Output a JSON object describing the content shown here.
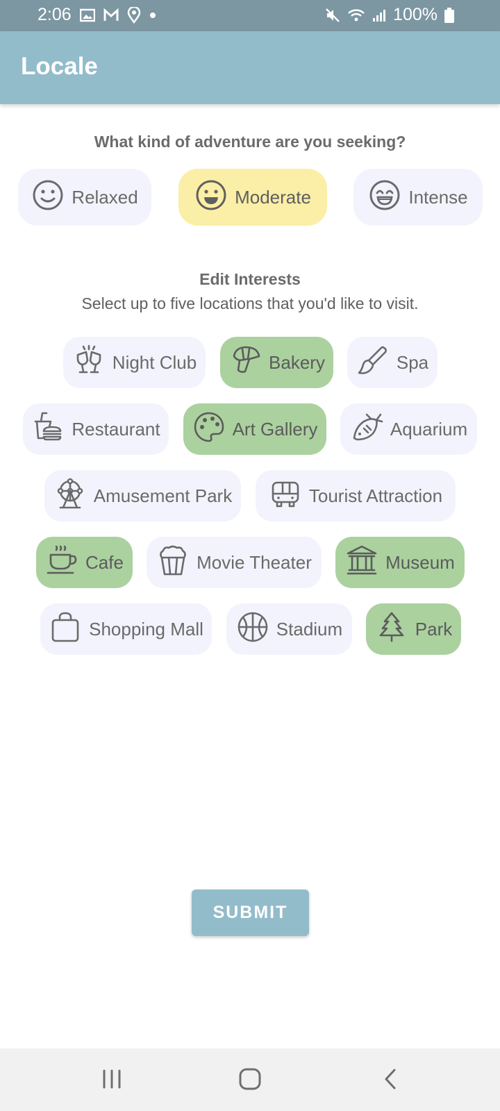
{
  "status_bar": {
    "time": "2:06",
    "battery": "100%"
  },
  "app_bar": {
    "title": "Locale"
  },
  "adventure": {
    "question": "What kind of adventure are you seeking?",
    "options": [
      {
        "label": "Relaxed",
        "icon": "smile-icon"
      },
      {
        "label": "Moderate",
        "icon": "smile-icon",
        "selected": true
      },
      {
        "label": "Intense",
        "icon": "grin-icon"
      }
    ]
  },
  "interests": {
    "title": "Edit Interests",
    "subtitle": "Select up to five locations that you'd like to visit.",
    "items": [
      {
        "label": "Night Club",
        "icon": "glasses-cheers-icon",
        "selected": false
      },
      {
        "label": "Bakery",
        "icon": "croissant-icon",
        "selected": true
      },
      {
        "label": "Spa",
        "icon": "brush-icon",
        "selected": false
      },
      {
        "label": "Restaurant",
        "icon": "fast-food-icon",
        "selected": false
      },
      {
        "label": "Art Gallery",
        "icon": "palette-icon",
        "selected": true
      },
      {
        "label": "Aquarium",
        "icon": "fish-icon",
        "selected": false
      },
      {
        "label": "Amusement Park",
        "icon": "ferris-wheel-icon",
        "selected": false
      },
      {
        "label": "Tourist Attraction",
        "icon": "bus-icon",
        "selected": false
      },
      {
        "label": "Cafe",
        "icon": "coffee-cup-icon",
        "selected": true
      },
      {
        "label": "Movie Theater",
        "icon": "popcorn-icon",
        "selected": false
      },
      {
        "label": "Museum",
        "icon": "building-columns-icon",
        "selected": true
      },
      {
        "label": "Shopping Mall",
        "icon": "shopping-bag-icon",
        "selected": false
      },
      {
        "label": "Stadium",
        "icon": "basketball-icon",
        "selected": false
      },
      {
        "label": "Park",
        "icon": "tree-icon",
        "selected": true
      }
    ]
  },
  "submit_label": "SUBMIT",
  "colors": {
    "status_bar": "#7c96a2",
    "app_bar": "#93bccb",
    "chip_selected": "#abd19f",
    "chip_default": "#f3f3fd",
    "mood_selected": "#fbeea6"
  }
}
